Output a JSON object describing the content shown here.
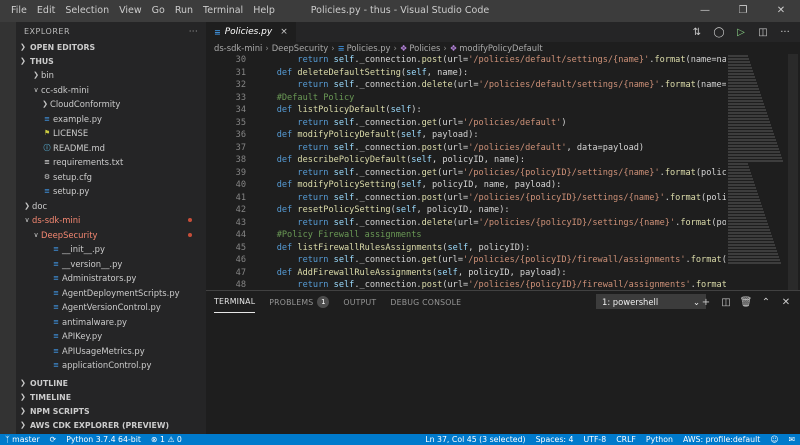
{
  "window": {
    "title": "Policies.py - thus - Visual Studio Code",
    "menu": [
      "File",
      "Edit",
      "Selection",
      "View",
      "Go",
      "Run",
      "Terminal",
      "Help"
    ]
  },
  "sidebar": {
    "title": "EXPLORER",
    "more": "···",
    "open_editors": "OPEN EDITORS",
    "root": "THUS",
    "tree": [
      {
        "label": "bin",
        "type": "folder",
        "depth": 1,
        "open": false
      },
      {
        "label": "cc-sdk-mini",
        "type": "folder",
        "depth": 1,
        "open": true
      },
      {
        "label": "CloudConformity",
        "type": "folder",
        "depth": 2,
        "open": false
      },
      {
        "label": "example.py",
        "type": "py",
        "depth": 1
      },
      {
        "label": "LICENSE",
        "type": "license",
        "depth": 1
      },
      {
        "label": "README.md",
        "type": "md",
        "depth": 1
      },
      {
        "label": "requirements.txt",
        "type": "txt",
        "depth": 1
      },
      {
        "label": "setup.cfg",
        "type": "cfg",
        "depth": 1
      },
      {
        "label": "setup.py",
        "type": "py",
        "depth": 1
      },
      {
        "label": "doc",
        "type": "folder",
        "depth": 0,
        "open": false
      },
      {
        "label": "ds-sdk-mini",
        "type": "folder",
        "depth": 0,
        "open": true,
        "modified": true
      },
      {
        "label": "DeepSecurity",
        "type": "folder",
        "depth": 1,
        "open": true,
        "modified": true
      },
      {
        "label": "__init__.py",
        "type": "py",
        "depth": 2
      },
      {
        "label": "__version__.py",
        "type": "py",
        "depth": 2
      },
      {
        "label": "Administrators.py",
        "type": "py",
        "depth": 2
      },
      {
        "label": "AgentDeploymentScripts.py",
        "type": "py",
        "depth": 2
      },
      {
        "label": "AgentVersionControl.py",
        "type": "py",
        "depth": 2
      },
      {
        "label": "antimalware.py",
        "type": "py",
        "depth": 2
      },
      {
        "label": "APIKey.py",
        "type": "py",
        "depth": 2
      },
      {
        "label": "APIUsageMetrics.py",
        "type": "py",
        "depth": 2
      },
      {
        "label": "applicationControl.py",
        "type": "py",
        "depth": 2
      }
    ],
    "bottom_sections": [
      "OUTLINE",
      "TIMELINE",
      "NPM SCRIPTS",
      "AWS CDK EXPLORER (PREVIEW)"
    ]
  },
  "editor": {
    "tab_label": "Policies.py",
    "tab_close": "×",
    "breadcrumb": [
      "ds-sdk-mini",
      "DeepSecurity",
      "Policies.py",
      "Policies",
      "modifyPolicyDefault"
    ],
    "lines": [
      {
        "n": "30",
        "t": "        return self._connection.post(url='/policies/default/settings/{name}'.format(name=name), data=pa"
      },
      {
        "n": "31",
        "t": "    def deleteDefaultSetting(self, name):"
      },
      {
        "n": "32",
        "t": "        return self._connection.delete(url='/policies/default/settings/{name}'.format(name=name))"
      },
      {
        "n": "33",
        "t": "    #Default Policy"
      },
      {
        "n": "34",
        "t": "    def listPolicyDefault(self):"
      },
      {
        "n": "35",
        "t": "        return self._connection.get(url='/policies/default')"
      },
      {
        "n": "36",
        "t": "    def modifyPolicyDefault(self, payload):"
      },
      {
        "n": "37",
        "t": "        return self._connection.post(url='/policies/default', data=payload)"
      },
      {
        "n": "38",
        "t": "    def describePolicyDefault(self, policyID, name):"
      },
      {
        "n": "39",
        "t": "        return self._connection.get(url='/policies/{policyID}/settings/{name}'.format(policyID=policyID,"
      },
      {
        "n": "40",
        "t": "    def modifyPolicySetting(self, policyID, name, payload):"
      },
      {
        "n": "41",
        "t": "        return self._connection.post(url='/policies/{policyID}/settings/{name}'.format(policyID=policyID"
      },
      {
        "n": "42",
        "t": "    def resetPolicySetting(self, policyID, name):"
      },
      {
        "n": "43",
        "t": "        return self._connection.delete(url='/policies/{policyID}/settings/{name}'.format(policyID=policy"
      },
      {
        "n": "44",
        "t": "    #Policy Firewall assignments"
      },
      {
        "n": "45",
        "t": "    def listFirewallRulesAssignments(self, policyID):"
      },
      {
        "n": "46",
        "t": "        return self._connection.get(url='/policies/{policyID}/firewall/assignments'.format(policyID=str"
      },
      {
        "n": "47",
        "t": "    def AddFirewallRuleAssignments(self, policyID, payload):"
      },
      {
        "n": "48",
        "t": "        return self._connection.post(url='/policies/{policyID}/firewall/assignments'.format(policyID=po"
      }
    ]
  },
  "panel": {
    "tabs": [
      "TERMINAL",
      "PROBLEMS",
      "OUTPUT",
      "DEBUG CONSOLE"
    ],
    "problems_count": "1",
    "terminal_select": "1: powershell"
  },
  "statusbar": {
    "branch": "master",
    "python": "Python 3.7.4 64-bit",
    "errors": "1",
    "warnings": "0",
    "position": "Ln 37, Col 45 (3 selected)",
    "spaces": "Spaces: 4",
    "encoding": "UTF-8",
    "eol": "CRLF",
    "language": "Python",
    "aws": "AWS: profile:default"
  },
  "colors": {
    "accent": "#007acc",
    "titlebar": "#3c3c3c",
    "sidebar": "#252526",
    "editor": "#1e1e1e",
    "modified": "#f48771"
  }
}
